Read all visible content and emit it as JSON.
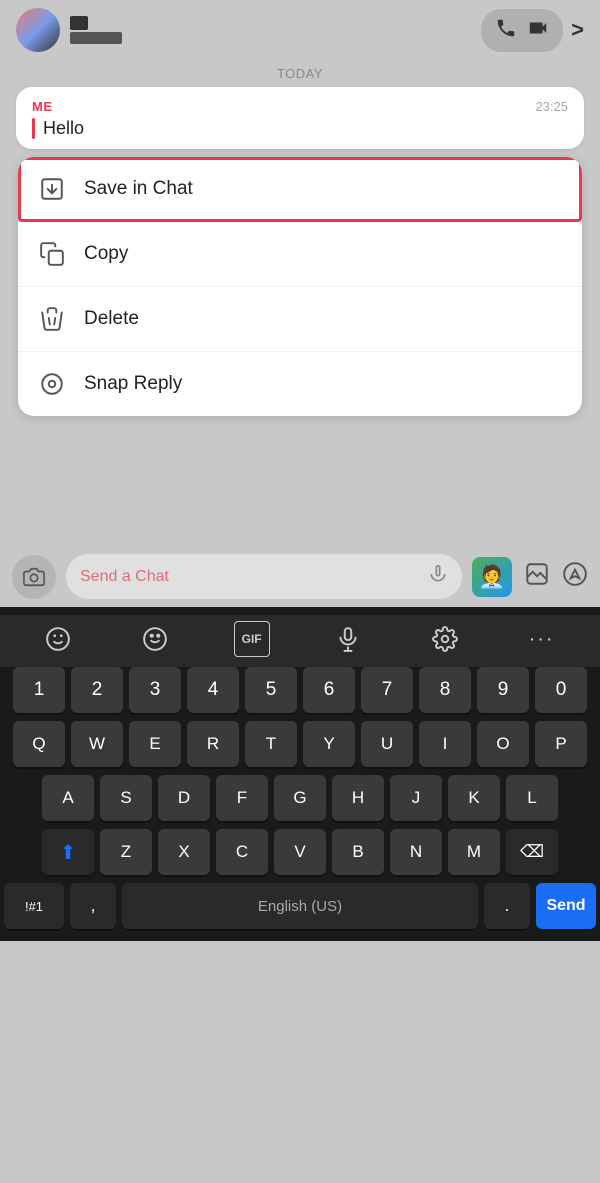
{
  "topbar": {
    "call_icon_label": "call",
    "video_icon_label": "video",
    "chevron_label": ">"
  },
  "chat": {
    "today_label": "TODAY",
    "message": {
      "sender": "ME",
      "time": "23:25",
      "text": "Hello"
    }
  },
  "context_menu": {
    "items": [
      {
        "id": "save-in-chat",
        "label": "Save in Chat",
        "icon": "save-icon",
        "highlighted": true
      },
      {
        "id": "copy",
        "label": "Copy",
        "icon": "copy-icon",
        "highlighted": false
      },
      {
        "id": "delete",
        "label": "Delete",
        "icon": "delete-icon",
        "highlighted": false
      },
      {
        "id": "snap-reply",
        "label": "Snap Reply",
        "icon": "snap-reply-icon",
        "highlighted": false
      }
    ]
  },
  "bottom_bar": {
    "input_placeholder": "Send a Chat",
    "bitmoji_label": "🧑‍💼"
  },
  "keyboard": {
    "toolbar": {
      "emoji_label": "☺",
      "gif_label": "GIF",
      "mic_label": "mic",
      "settings_label": "⚙",
      "more_label": "..."
    },
    "rows": {
      "numbers": [
        "1",
        "2",
        "3",
        "4",
        "5",
        "6",
        "7",
        "8",
        "9",
        "0"
      ],
      "row1": [
        "Q",
        "W",
        "E",
        "R",
        "T",
        "Y",
        "U",
        "I",
        "O",
        "P"
      ],
      "row2": [
        "A",
        "S",
        "D",
        "F",
        "G",
        "H",
        "J",
        "K",
        "L"
      ],
      "row3": [
        "Z",
        "X",
        "C",
        "V",
        "B",
        "N",
        "M"
      ],
      "bottom": {
        "special": "!#1",
        "comma": ",",
        "space": "English (US)",
        "period": ".",
        "send": "Send"
      }
    }
  }
}
